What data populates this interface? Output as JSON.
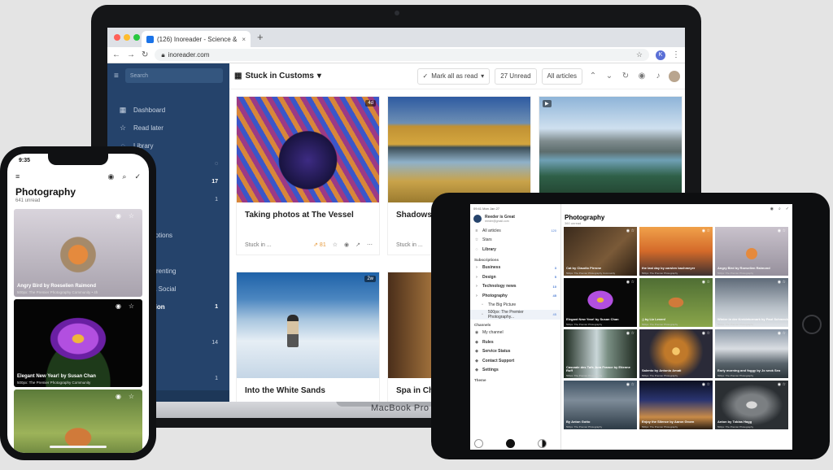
{
  "laptop": {
    "brand": "MacBook Pro",
    "browser": {
      "tab_title": "(126) Inoreader - Science & S...",
      "tab_close": "×",
      "new_tab": "+",
      "url": "inoreader.com",
      "profile_initial": "K"
    },
    "sidebar": {
      "search_placeholder": "Search",
      "items": [
        {
          "icon": "▦",
          "label": "Dashboard",
          "count": ""
        },
        {
          "icon": "☆",
          "label": "Read later",
          "count": ""
        },
        {
          "icon": "◌",
          "label": "Library",
          "count": ""
        },
        {
          "icon": "",
          "label": "",
          "count": "◌"
        },
        {
          "icon": "",
          "label": "s",
          "count": "17"
        },
        {
          "icon": "",
          "label": "",
          "count": "1"
        },
        {
          "icon": "",
          "label": "",
          "count": ""
        },
        {
          "icon": "",
          "label": "Subscriptions",
          "count": ""
        },
        {
          "icon": "",
          "label": "rs",
          "count": ""
        },
        {
          "icon": "",
          "label": "gy & Parenting",
          "count": ""
        },
        {
          "icon": "",
          "label": "rticles & Social",
          "count": ""
        },
        {
          "icon": "",
          "label": "nspiration",
          "count": "1"
        },
        {
          "icon": "",
          "label": "Space",
          "count": ""
        },
        {
          "icon": "",
          "label": "",
          "count": "14"
        },
        {
          "icon": "",
          "label": "",
          "count": ""
        },
        {
          "icon": "",
          "label": "r News",
          "count": "1"
        },
        {
          "icon": "",
          "label": "omer Reviews",
          "count": ""
        }
      ]
    },
    "toolbar": {
      "feed_title": "Stuck in Customs",
      "mark_all_read": "Mark all as read",
      "unread": "27 Unread",
      "all_articles": "All articles"
    },
    "cards": [
      {
        "title": "Taking photos at The Vessel",
        "badge": "4d",
        "source": "Stuck in ...",
        "popularity": "⇗ 81",
        "image": "img-vessel",
        "badge_left": false
      },
      {
        "title": "Shadows",
        "badge": "",
        "source": "Stuck in ...",
        "popularity": "",
        "image": "img-lake1",
        "badge_left": false
      },
      {
        "title": "",
        "badge": "▶",
        "source": "",
        "popularity": "",
        "image": "img-lake2",
        "badge_left": true
      },
      {
        "title": "Into the White Sands",
        "badge": "2w",
        "source": "",
        "popularity": "",
        "image": "img-desert",
        "badge_left": false
      },
      {
        "title": "Spa in Ch",
        "badge": "",
        "source": "",
        "popularity": "",
        "image": "img-spa",
        "badge_left": false
      }
    ]
  },
  "phone": {
    "time": "9:35",
    "title": "Photography",
    "subtitle": "641 unread",
    "cards": [
      {
        "caption": "Angry Bird by Roeselien Raimond",
        "source": "500px: The Premier Photography Community • 4h",
        "image": "img-robin"
      },
      {
        "caption": "Elegant New Year! by Susan Chan",
        "source": "500px: The Premier Photography Community",
        "image": "img-lily"
      },
      {
        "caption": "",
        "source": "",
        "image": "img-fox"
      }
    ]
  },
  "tablet": {
    "status_time": "09:41 Mon Jan 27",
    "user_name": "Reeder is Great",
    "user_mail": "reeder@gmail.com",
    "title": "Photography",
    "subtitle": "360 unread",
    "nav": [
      {
        "icon": "≡",
        "label": "All articles",
        "count": "120",
        "cls": ""
      },
      {
        "icon": "☆",
        "label": "Stars",
        "count": "",
        "cls": ""
      },
      {
        "icon": "◌",
        "label": "Library",
        "count": "",
        "cls": "b"
      }
    ],
    "subs_label": "Subscriptions",
    "subs": [
      {
        "icon": "›",
        "label": "Business",
        "count": "3",
        "cls": "b"
      },
      {
        "icon": "›",
        "label": "Design",
        "count": "5",
        "cls": "b"
      },
      {
        "icon": "›",
        "label": "Technology news",
        "count": "10",
        "cls": "b"
      },
      {
        "icon": "›",
        "label": "Photography",
        "count": "45",
        "cls": "b"
      },
      {
        "icon": "▫",
        "label": "The Big Picture",
        "count": "",
        "cls": "indent"
      },
      {
        "icon": "▫",
        "label": "500px: The Premier Photography...",
        "count": "45",
        "cls": "indent sel"
      }
    ],
    "channels_label": "Channels",
    "channels": [
      {
        "icon": "◉",
        "label": "My channel",
        "count": "",
        "cls": ""
      }
    ],
    "tools": [
      {
        "icon": "◈",
        "label": "Rules",
        "count": "",
        "cls": "b"
      },
      {
        "icon": "◈",
        "label": "Service Status",
        "count": "",
        "cls": "b"
      },
      {
        "icon": "◈",
        "label": "Contact Support",
        "count": "",
        "cls": "b"
      },
      {
        "icon": "◈",
        "label": "Settings",
        "count": "",
        "cls": "b"
      }
    ],
    "theme_label": "Theme",
    "grid": [
      {
        "caption": "Cat by Claudio Pirrone",
        "source": "500px: The Premier Photography Community",
        "image": "c1"
      },
      {
        "caption": "the last day by carsten bachmeyer",
        "source": "500px: The Premier Photography",
        "image": "c2"
      },
      {
        "caption": "Angry Bird by Roeselien Raimond",
        "source": "500px: The Premier Photography",
        "image": "c3"
      },
      {
        "caption": "Elegant New Year! by Susan Chan",
        "source": "500px: The Premier Photography",
        "image": "c4"
      },
      {
        "caption": ";) by Liz Leven!",
        "source": "500px: The Premier Photography",
        "image": "c5"
      },
      {
        "caption": "Winter in der Kreidetormark by Paul Schmeck",
        "source": "500px: The Premier Photography",
        "image": "c6"
      },
      {
        "caption": "Cascade des Tufs Jura France by Etienne Ruff",
        "source": "500px: The Premier Photography",
        "image": "c7"
      },
      {
        "caption": "Salento by Antonio Amati",
        "source": "500px: The Premier Photography",
        "image": "c8"
      },
      {
        "caption": "Early morning and foggy by Jo seok Seo",
        "source": "500px: The Premier Photography",
        "image": "c9"
      },
      {
        "caption": "By Anton Gotto",
        "source": "500px: The Premier Photography",
        "image": "c10"
      },
      {
        "caption": "Enjoy the Silence by Aaron Groen",
        "source": "500px: The Premier Photography",
        "image": "c11"
      },
      {
        "caption": "Anton by Tobias Hagg",
        "source": "500px: The Premier Photography",
        "image": "c12"
      }
    ]
  }
}
